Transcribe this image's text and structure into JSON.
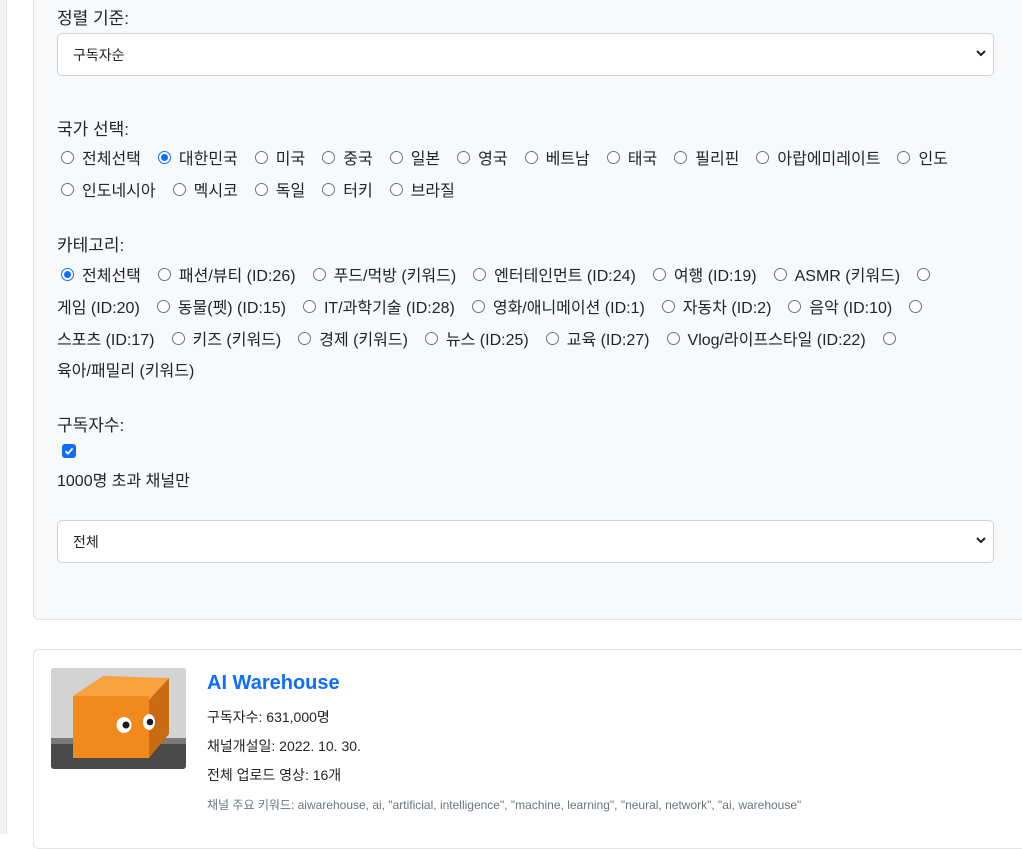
{
  "sort": {
    "label": "정렬 기준:",
    "selected": "구독자순"
  },
  "country": {
    "label": "국가 선택:",
    "options": [
      {
        "label": "전체선택",
        "checked": false
      },
      {
        "label": "대한민국",
        "checked": true
      },
      {
        "label": "미국",
        "checked": false
      },
      {
        "label": "중국",
        "checked": false
      },
      {
        "label": "일본",
        "checked": false
      },
      {
        "label": "영국",
        "checked": false
      },
      {
        "label": "베트남",
        "checked": false
      },
      {
        "label": "태국",
        "checked": false
      },
      {
        "label": "필리핀",
        "checked": false
      },
      {
        "label": "아랍에미레이트",
        "checked": false
      },
      {
        "label": "인도",
        "checked": false
      },
      {
        "label": "인도네시아",
        "checked": false
      },
      {
        "label": "멕시코",
        "checked": false
      },
      {
        "label": "독일",
        "checked": false
      },
      {
        "label": "터키",
        "checked": false
      },
      {
        "label": "브라질",
        "checked": false
      }
    ]
  },
  "category": {
    "label": "카테고리:",
    "options": [
      {
        "label": "전체선택",
        "checked": true
      },
      {
        "label": "패션/뷰티 (ID:26)",
        "checked": false
      },
      {
        "label": "푸드/먹방 (키워드)",
        "checked": false
      },
      {
        "label": "엔터테인먼트 (ID:24)",
        "checked": false
      },
      {
        "label": "여행 (ID:19)",
        "checked": false
      },
      {
        "label": "ASMR (키워드)",
        "checked": false
      },
      {
        "label": "게임 (ID:20)",
        "checked": false
      },
      {
        "label": "동물(펫) (ID:15)",
        "checked": false
      },
      {
        "label": "IT/과학기술 (ID:28)",
        "checked": false
      },
      {
        "label": "영화/애니메이션 (ID:1)",
        "checked": false
      },
      {
        "label": "자동차 (ID:2)",
        "checked": false
      },
      {
        "label": "음악 (ID:10)",
        "checked": false
      },
      {
        "label": "스포츠 (ID:17)",
        "checked": false
      },
      {
        "label": "키즈 (키워드)",
        "checked": false
      },
      {
        "label": "경제 (키워드)",
        "checked": false
      },
      {
        "label": "뉴스 (ID:25)",
        "checked": false
      },
      {
        "label": "교육 (ID:27)",
        "checked": false
      },
      {
        "label": "Vlog/라이프스타일 (ID:22)",
        "checked": false
      },
      {
        "label": "육아/패밀리 (키워드)",
        "checked": false
      }
    ]
  },
  "subscribers": {
    "label": "구독자수:",
    "checkbox_checked": true,
    "checkbox_label": "1000명 초과 채널만",
    "range_selected": "전체"
  },
  "channel": {
    "title": "AI Warehouse",
    "subscribers": "구독자수: 631,000명",
    "created": "채널개설일: 2022. 10. 30.",
    "videos": "전체 업로드 영상: 16개",
    "keywords": "채널 주요 키워드: aiwarehouse, ai, \"artificial, intelligence\", \"machine, learning\", \"neural, network\", \"ai, warehouse\""
  },
  "colors": {
    "accent": "#0d6efd",
    "panel_bg": "#f8f9fa",
    "muted_text": "#6c757d"
  }
}
